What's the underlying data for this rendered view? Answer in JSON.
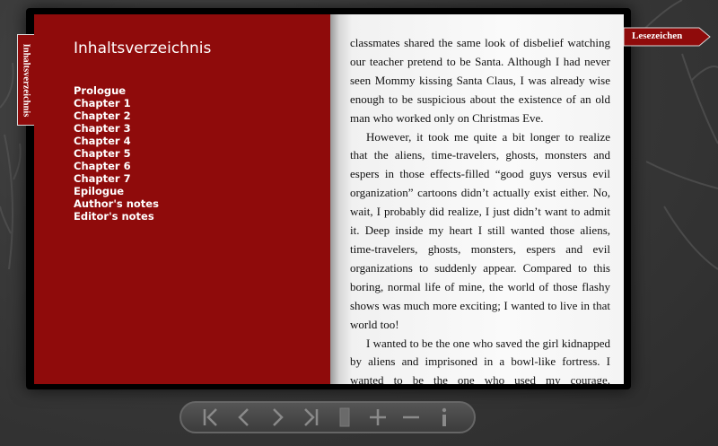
{
  "toc": {
    "title": "Inhaltsverzeichnis",
    "items": [
      {
        "label": "Prologue"
      },
      {
        "label": "Chapter 1"
      },
      {
        "label": "Chapter 2"
      },
      {
        "label": "Chapter 3"
      },
      {
        "label": "Chapter 4"
      },
      {
        "label": "Chapter 5"
      },
      {
        "label": "Chapter 6"
      },
      {
        "label": "Chapter 7"
      },
      {
        "label": "Epilogue"
      },
      {
        "label": "Author's notes"
      },
      {
        "label": "Editor's notes"
      }
    ]
  },
  "side_tab": {
    "label": "Inhaltsverzeichnis"
  },
  "bookmark": {
    "label": "Lesezeichen"
  },
  "page": {
    "paragraphs": [
      "classmates shared the same look of disbelief watching our teacher pretend to be Santa. Although I had never seen Mommy kissing Santa Claus, I was already wise enough to be suspicious about the existence of an old man who worked only on Christmas Eve.",
      "However, it took me quite a bit longer to realize that the aliens, time-travelers, ghosts, monsters and espers in those effects-filled “good guys versus evil organization” cartoons didn’t actually exist either. No, wait, I probably did realize, I just didn’t want to admit it. Deep inside my heart I still wanted those aliens, time-travelers, ghosts, monsters, espers and evil organizations to suddenly appear. Compared to this boring, normal life of mine, the world of those flashy shows was much more exciting; I wanted to live in that world too!",
      "I wanted to be the one who saved the girl kidnapped by aliens and imprisoned in a bowl-like fortress. I wanted to be the one who used my courage, intelligence and trusty laser gun to fight against villains from the future trying to change history for their own"
    ]
  },
  "toolbar": {
    "buttons": [
      {
        "icon": "first-page-icon"
      },
      {
        "icon": "previous-page-icon"
      },
      {
        "icon": "next-page-icon"
      },
      {
        "icon": "last-page-icon"
      },
      {
        "icon": "page-view-icon"
      },
      {
        "icon": "zoom-in-icon"
      },
      {
        "icon": "zoom-out-icon"
      },
      {
        "icon": "info-icon"
      }
    ]
  },
  "colors": {
    "cover_red": "#8f0b0b",
    "background": "#3a3a3a",
    "toolbar_icon": "#8a8a8a"
  }
}
